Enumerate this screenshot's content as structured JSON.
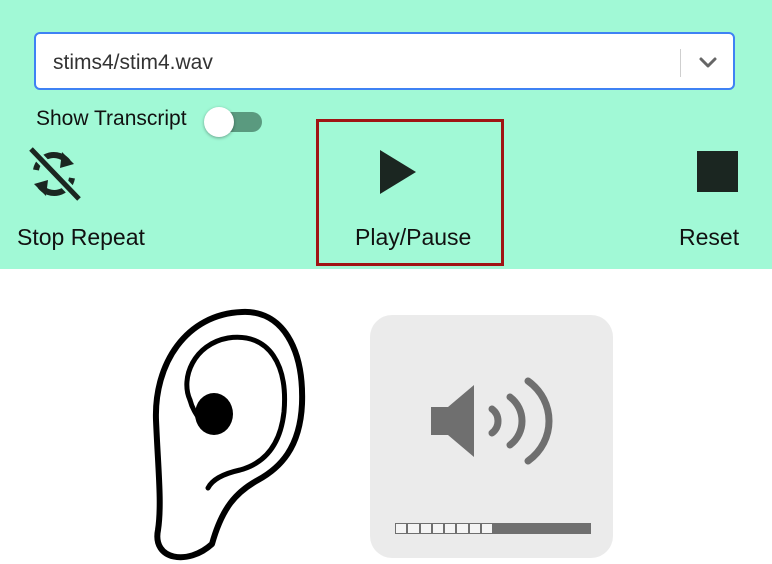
{
  "player": {
    "selected_file": "stims4/stim4.wav",
    "show_transcript_label": "Show Transcript",
    "show_transcript_on": false,
    "buttons": {
      "stop_repeat": {
        "label": "Stop Repeat",
        "icon": "repeat-off-icon"
      },
      "play_pause": {
        "label": "Play/Pause",
        "icon": "play-icon"
      },
      "reset": {
        "label": "Reset",
        "icon": "stop-square-icon"
      }
    },
    "highlighted_button": "play_pause"
  },
  "stimulus": {
    "ear_icon": "ear-icon",
    "speaker_icon": "speaker-volume-icon",
    "volume_level": 0.5
  },
  "colors": {
    "panel_bg": "#a1f9d6",
    "select_border": "#3f82f4",
    "highlight_border": "#a01414",
    "toggle_track": "#5a9a7f"
  }
}
